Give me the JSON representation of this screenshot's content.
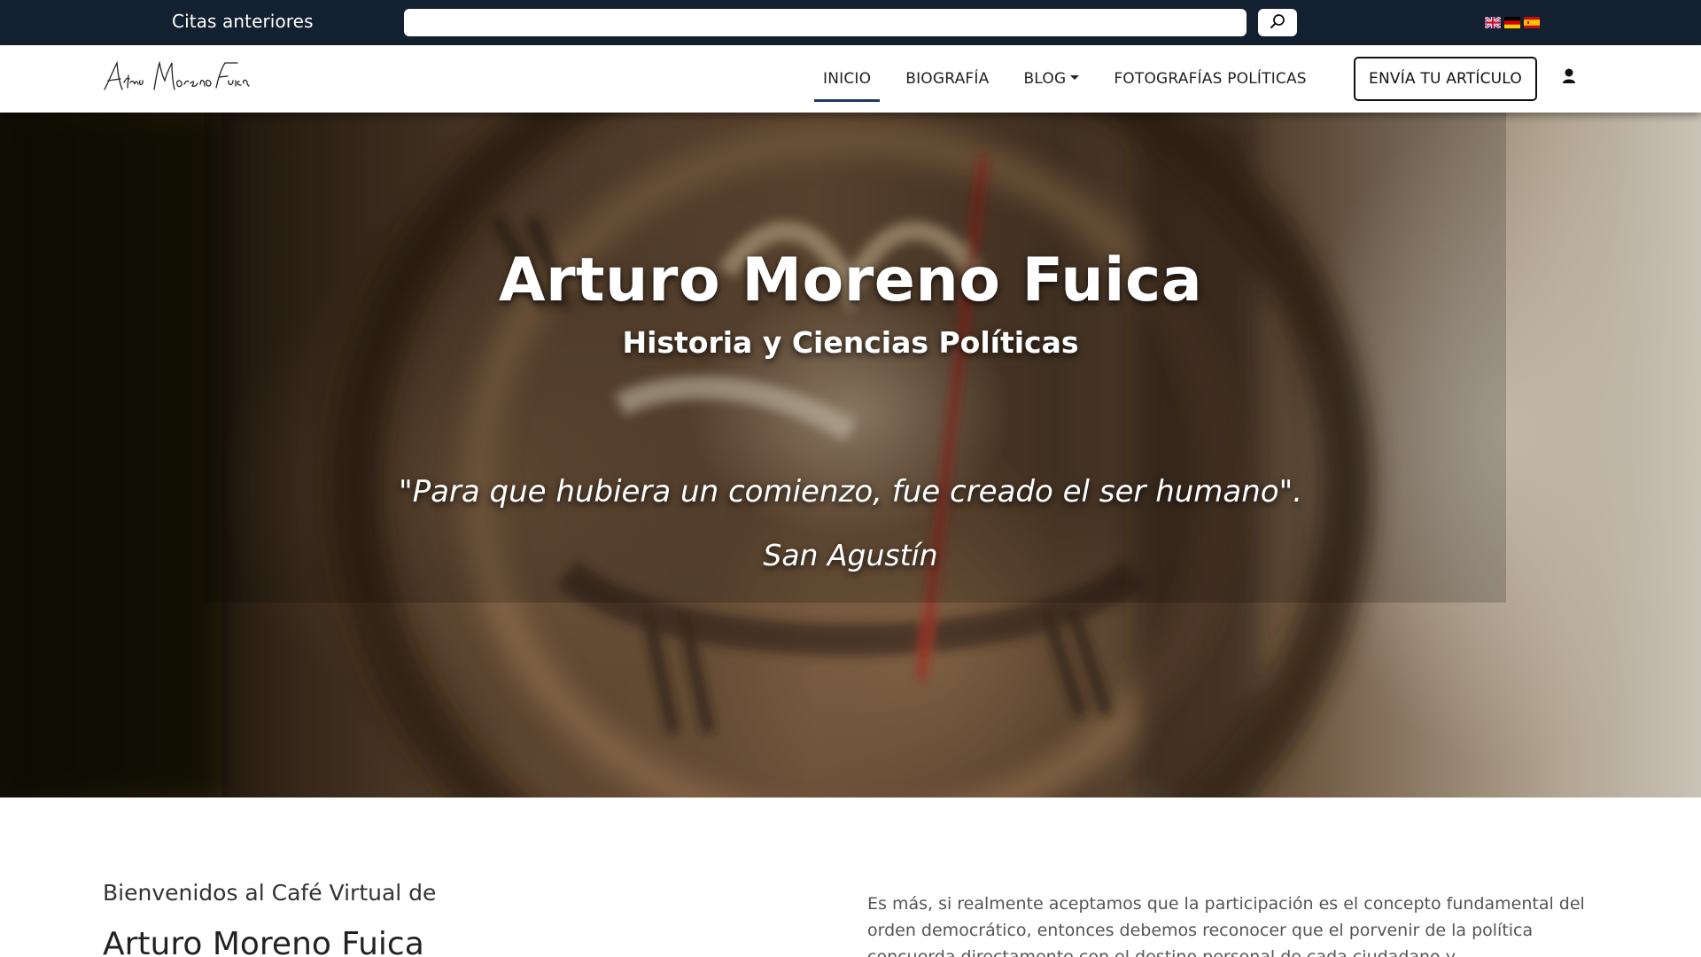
{
  "topbar": {
    "quotes_link": "Citas anteriores",
    "search_placeholder": "",
    "search_icon": "search-icon",
    "languages": [
      {
        "name": "English",
        "icon": "flag-uk-icon"
      },
      {
        "name": "Deutsch",
        "icon": "flag-de-icon"
      },
      {
        "name": "Español",
        "icon": "flag-es-icon"
      }
    ]
  },
  "navbar": {
    "logo_alt": "Arturo Moreno Fuica",
    "items": [
      {
        "label": "INICIO",
        "active": true
      },
      {
        "label": "BIOGRAFÍA",
        "active": false
      },
      {
        "label": "BLOG",
        "active": false,
        "dropdown": true
      },
      {
        "label": "FOTOGRAFÍAS POLÍTICAS",
        "active": false
      }
    ],
    "cta_label": "ENVÍA TU ARTÍCULO",
    "user_icon": "user-icon"
  },
  "hero": {
    "title": "Arturo Moreno Fuica",
    "subtitle": "Historia y Ciencias Políticas",
    "quote": "\"Para que hubiera un comienzo, fue creado el ser humano\".",
    "author": "San Agustín"
  },
  "content": {
    "welcome": "Bienvenidos al Café Virtual de",
    "name": "Arturo Moreno Fuica",
    "intro": "Es más, si realmente aceptamos que la participación es el concepto fundamental del orden democrático, entonces debemos reconocer que el porvenir de la política concuerda directamente con el destino personal de cada ciudadano y"
  },
  "colors": {
    "topbar_bg": "#13202f",
    "active_underline": "#1f3a60",
    "text_dark": "#222222",
    "text_muted": "#555555"
  }
}
